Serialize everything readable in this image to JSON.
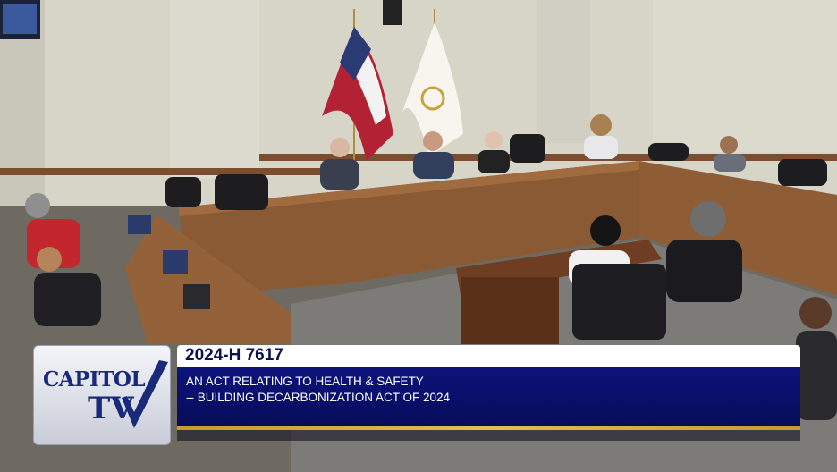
{
  "broadcast": {
    "channel_logo_text": "CAPITOL",
    "channel_logo_tv": "TV",
    "bill_number": "2024-H 7617",
    "bill_title_line1": "AN ACT RELATING TO HEALTH & SAFETY",
    "bill_title_line2": "-- BUILDING DECARBONIZATION ACT OF 2024"
  },
  "colors": {
    "title_bar": "#0c137c",
    "accent": "#d4a93c",
    "logo_text": "#1a2a7a"
  }
}
